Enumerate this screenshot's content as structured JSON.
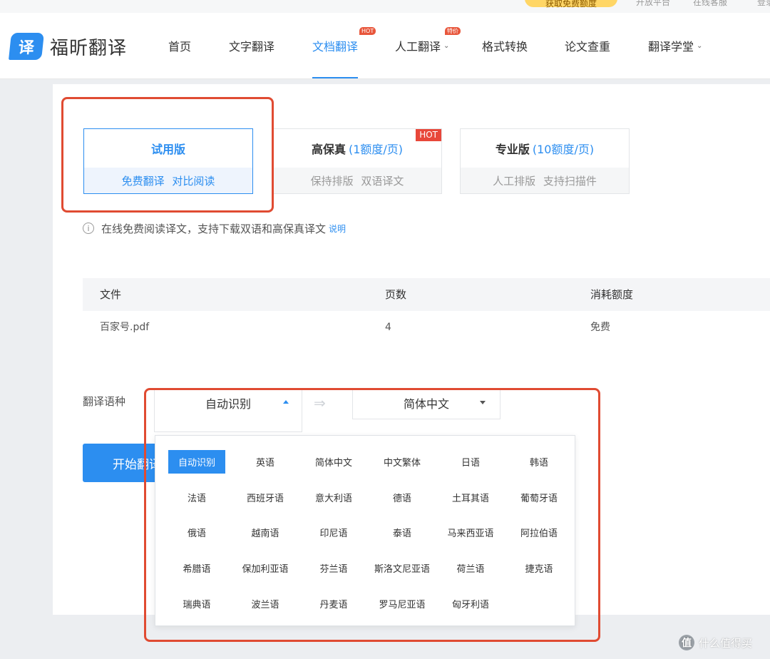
{
  "topbar": {
    "promo": "获取免费额度",
    "links": [
      "开放平台",
      "在线客服",
      "登录"
    ]
  },
  "header": {
    "logo_glyph": "译",
    "logo_text": "福昕翻译",
    "nav": [
      {
        "label": "首页",
        "caret": false,
        "badge": ""
      },
      {
        "label": "文字翻译",
        "caret": false,
        "badge": ""
      },
      {
        "label": "文档翻译",
        "caret": false,
        "badge": "HOT",
        "active": true
      },
      {
        "label": "人工翻译",
        "caret": true,
        "badge": "特价"
      },
      {
        "label": "格式转换",
        "caret": false,
        "badge": ""
      },
      {
        "label": "论文查重",
        "caret": false,
        "badge": ""
      },
      {
        "label": "翻译学堂",
        "caret": true,
        "badge": ""
      }
    ]
  },
  "plans": [
    {
      "title": "试用版",
      "cost": "",
      "subtitle": "免费翻译 对比阅读",
      "selected": true,
      "badge": ""
    },
    {
      "title": "高保真",
      "cost": "(1额度/页)",
      "subtitle": "保持排版 双语译文",
      "selected": false,
      "badge": "HOT"
    },
    {
      "title": "专业版",
      "cost": "(10额度/页)",
      "subtitle": "人工排版 支持扫描件",
      "selected": false,
      "badge": ""
    }
  ],
  "note": {
    "text": "在线免费阅读译文，支持下载双语和高保真译文",
    "link": "说明",
    "icon": "info-icon"
  },
  "file_table": {
    "headers": [
      "文件",
      "页数",
      "消耗额度"
    ],
    "rows": [
      [
        "百家号.pdf",
        "4",
        "免费"
      ]
    ]
  },
  "language": {
    "label": "翻译语种",
    "source": "自动识别",
    "target": "简体中文",
    "swap_icon": "swap-arrow-icon",
    "options": [
      "自动识别",
      "英语",
      "简体中文",
      "中文繁体",
      "日语",
      "韩语",
      "法语",
      "西班牙语",
      "意大利语",
      "德语",
      "土耳其语",
      "葡萄牙语",
      "俄语",
      "越南语",
      "印尼语",
      "泰语",
      "马来西亚语",
      "阿拉伯语",
      "希腊语",
      "保加利亚语",
      "芬兰语",
      "斯洛文尼亚语",
      "荷兰语",
      "捷克语",
      "瑞典语",
      "波兰语",
      "丹麦语",
      "罗马尼亚语",
      "匈牙利语"
    ],
    "active_option": "自动识别"
  },
  "start_button": "开始翻译",
  "watermark": {
    "icon_glyph": "值",
    "text": "什么值得买"
  },
  "colors": {
    "accent": "#2c8ef0",
    "annotation": "#e04b32",
    "hot": "#e8473a"
  }
}
